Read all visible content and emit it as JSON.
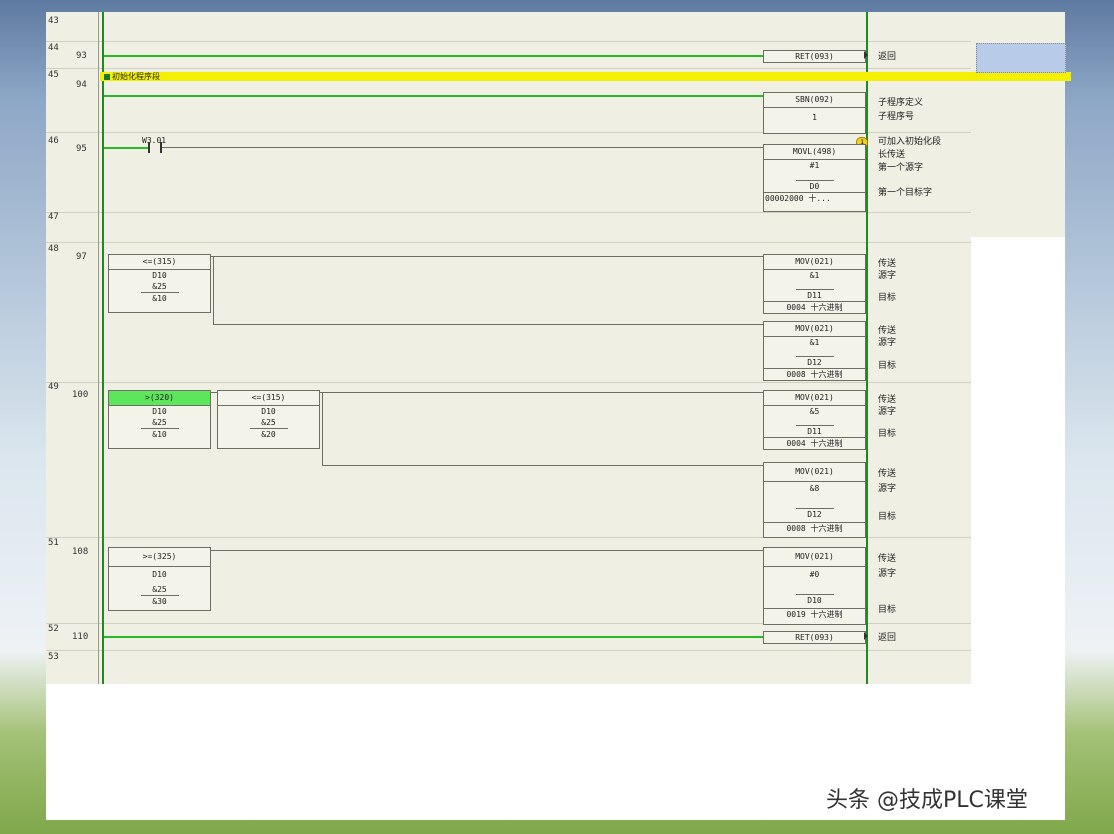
{
  "rows": {
    "r43": "43",
    "r44": "44",
    "r45": "45",
    "r46": "46",
    "r47": "47",
    "r48": "48",
    "r49": "49",
    "r51": "51",
    "r52": "52",
    "r53": "53"
  },
  "steps": {
    "s93": "93",
    "s94": "94",
    "s95": "95",
    "s97": "97",
    "s100": "100",
    "s108": "108",
    "s110": "110"
  },
  "section": {
    "label": "初始化程序段"
  },
  "contact": {
    "label": "W3.01"
  },
  "badge": "1",
  "blocks": {
    "ret1": "RET(093)",
    "sbn": {
      "hdr": "SBN(092)",
      "v": "1"
    },
    "movl": {
      "hdr": "MOVL(498)",
      "src": "#1",
      "dst": "D0",
      "foot": "00002000 十..."
    },
    "cmp1": {
      "hdr": "<=(315)",
      "a": "D10",
      "b": "&25",
      "c": "&10"
    },
    "mov1": {
      "hdr": "MOV(021)",
      "src": "&1",
      "dst": "D11",
      "foot": "0004 十六进制"
    },
    "mov2": {
      "hdr": "MOV(021)",
      "src": "&1",
      "dst": "D12",
      "foot": "0008 十六进制"
    },
    "cmp2": {
      "hdr": ">(320)",
      "a": "D10",
      "b": "&25",
      "c": "&10"
    },
    "cmp3": {
      "hdr": "<=(315)",
      "a": "D10",
      "b": "&25",
      "c": "&20"
    },
    "mov3": {
      "hdr": "MOV(021)",
      "src": "&5",
      "dst": "D11",
      "foot": "0004 十六进制"
    },
    "mov4": {
      "hdr": "MOV(021)",
      "src": "&8",
      "dst": "D12",
      "foot": "0008 十六进制"
    },
    "cmp4": {
      "hdr": ">=(325)",
      "a": "D10",
      "b": "&25",
      "c": "&30"
    },
    "mov5": {
      "hdr": "MOV(021)",
      "src": "#0",
      "dst": "D10",
      "foot": "0019 十六进制"
    },
    "ret2": "RET(093)"
  },
  "comments": {
    "c1": "返回",
    "c2": "子程序定义",
    "c3": "子程序号",
    "c4": "可加入初始化段",
    "c5": "长传送",
    "c6": "第一个源字",
    "c7": "第一个目标字",
    "c8": "传送",
    "c9": "源字",
    "c10": "目标",
    "c11": "传送",
    "c12": "源字",
    "c13": "目标",
    "c14": "传送",
    "c15": "源字",
    "c16": "目标",
    "c17": "传送",
    "c18": "源字",
    "c19": "目标",
    "c20": "传送",
    "c21": "源字",
    "c22": "目标",
    "c23": "返回"
  },
  "watermark": "头条 @技成PLC课堂"
}
